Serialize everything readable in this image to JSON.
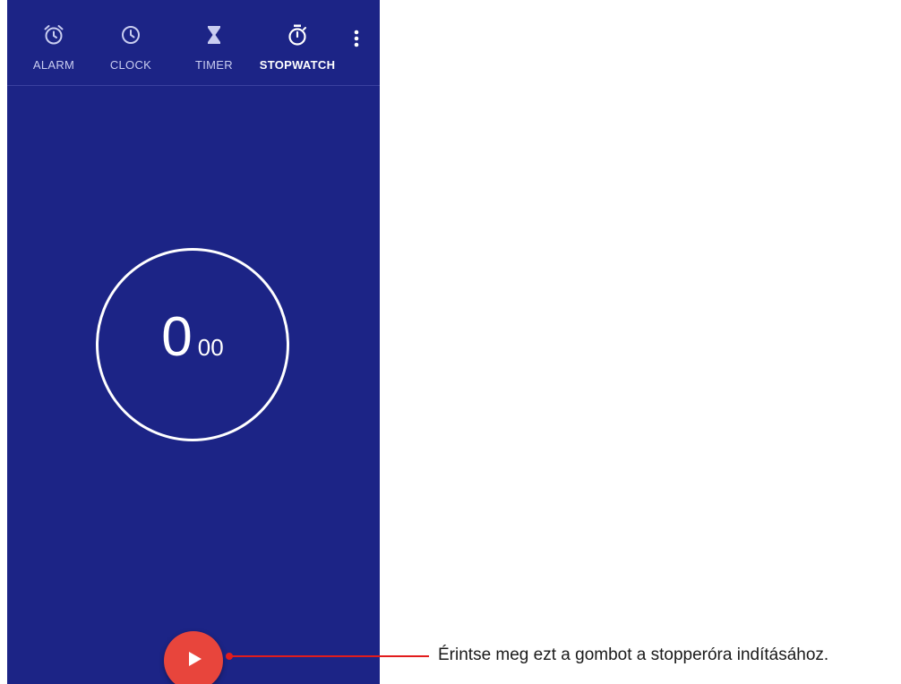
{
  "tabs": [
    {
      "label": "ALARM",
      "icon": "alarm-icon"
    },
    {
      "label": "CLOCK",
      "icon": "clock-icon"
    },
    {
      "label": "TIMER",
      "icon": "hourglass-icon"
    },
    {
      "label": "STOPWATCH",
      "icon": "stopwatch-icon",
      "active": true
    }
  ],
  "menu": {
    "icon": "more-vert-icon"
  },
  "stopwatch": {
    "seconds": "0",
    "hundredths": "00"
  },
  "play_button": {
    "icon": "play-icon"
  },
  "callout": {
    "text": "Érintse meg ezt a gombot a stopperóra indításához."
  },
  "colors": {
    "background": "#1c2486",
    "fab": "#e8453c",
    "callout_line": "#e21c1c",
    "tab_label": "#c9cdf0",
    "active_label": "#ffffff"
  }
}
